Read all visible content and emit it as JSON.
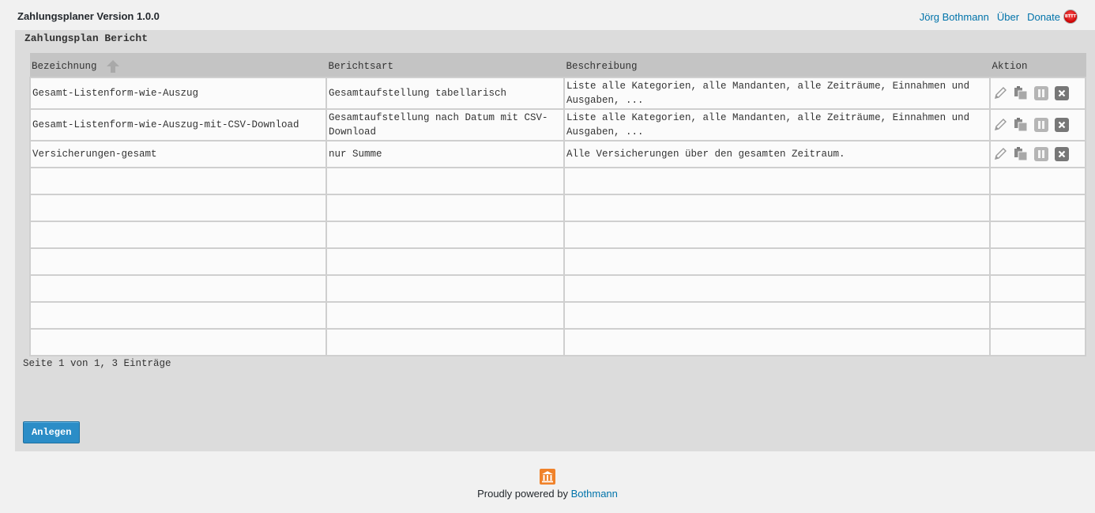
{
  "header": {
    "app_title": "Zahlungsplaner Version 1.0.0",
    "links": [
      "Jörg Bothmann",
      "Über",
      "Donate"
    ],
    "donate_icon_text": "BTTT"
  },
  "panel": {
    "title": "Zahlungsplan Bericht"
  },
  "table": {
    "columns": [
      "Bezeichnung",
      "Berichtsart",
      "Beschreibung",
      "Aktion"
    ],
    "rows": [
      {
        "name": "Gesamt-Listenform-wie-Auszug",
        "type": "Gesamtaufstellung tabellarisch",
        "description": "Liste alle Kategorien, alle Mandanten, alle Zeiträume, Einnahmen und Ausgaben, ..."
      },
      {
        "name": "Gesamt-Listenform-wie-Auszug-mit-CSV-Download",
        "type": "Gesamtaufstellung nach Datum mit CSV-Download",
        "description": "Liste alle Kategorien, alle Mandanten, alle Zeiträume, Einnahmen und Ausgaben, ..."
      },
      {
        "name": "Versicherungen-gesamt",
        "type": "nur Summe",
        "description": "Alle Versicherungen über den gesamten Zeitraum."
      }
    ],
    "action_icons": [
      "pencil-icon",
      "copy-icon",
      "pause-icon",
      "close-icon"
    ],
    "sort_icon": "arrow-up-icon"
  },
  "pager": {
    "text": "Seite 1 von 1, 3 Einträge"
  },
  "buttons": {
    "create_label": "Anlegen"
  },
  "footer": {
    "text": "Proudly powered by",
    "link": "Bothmann",
    "icon": "bank-icon",
    "icon_color": "#f0822a"
  },
  "colors": {
    "link": "#0073aa",
    "button": "#2b8dc7",
    "panel_bg": "#dcdcdc",
    "header_row_bg": "#c4c4c4"
  }
}
